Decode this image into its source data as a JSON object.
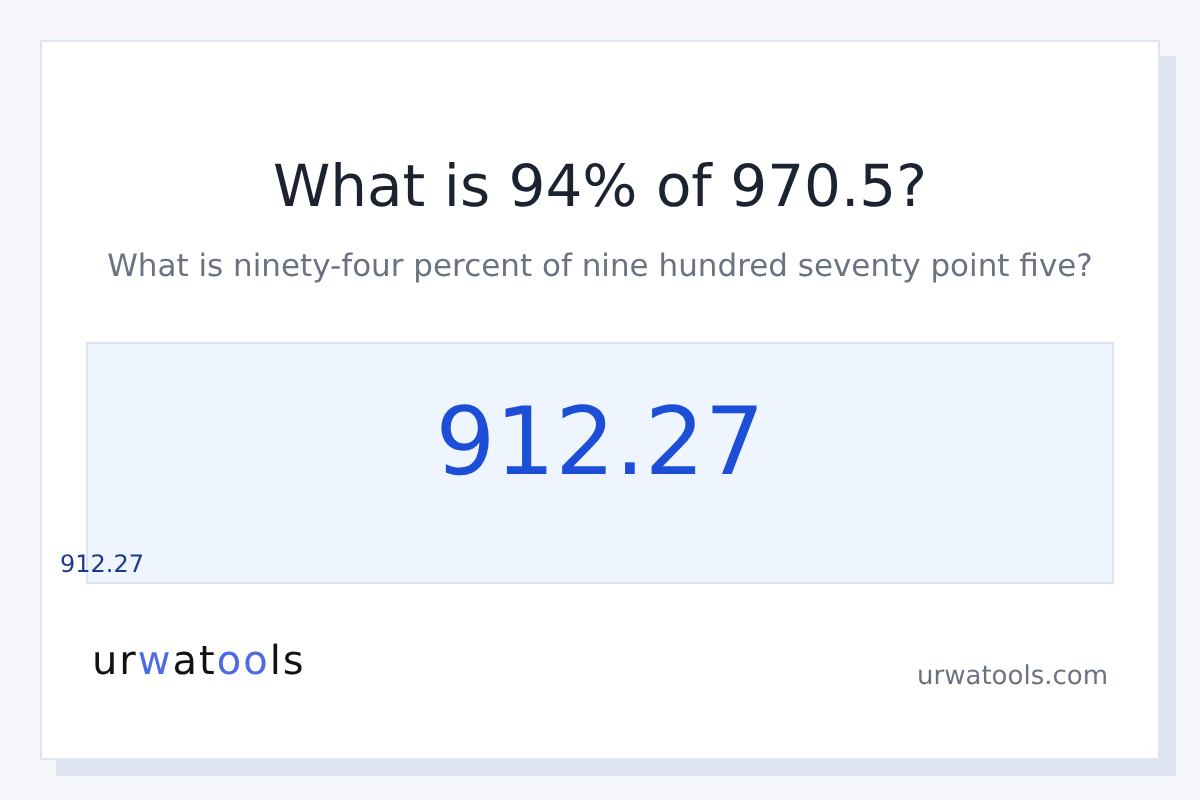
{
  "title": "What is 94% of 970.5?",
  "subtitle": "What is ninety-four percent of nine hundred seventy point five?",
  "result": "912.27",
  "result_small": "912.27",
  "logo": [
    {
      "text": "ur",
      "color": "#111111"
    },
    {
      "text": "w",
      "color": "#4f6ae6"
    },
    {
      "text": "at",
      "color": "#111111"
    },
    {
      "text": "oo",
      "color": "#4f6ae6"
    },
    {
      "text": "ls",
      "color": "#111111"
    }
  ],
  "site": "urwatools.com"
}
